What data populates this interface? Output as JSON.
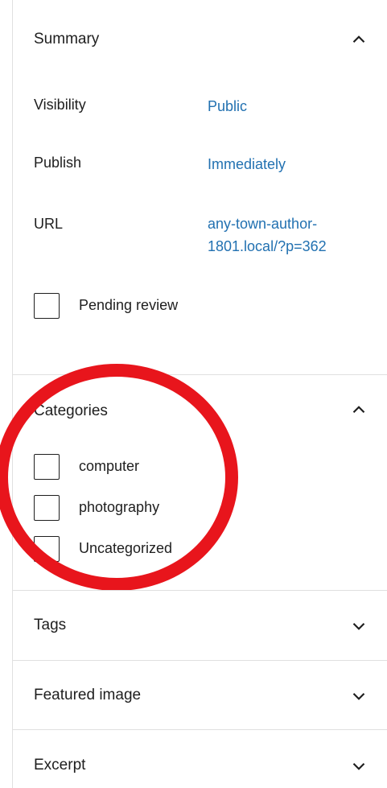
{
  "summary": {
    "title": "Summary",
    "visibility_label": "Visibility",
    "visibility_value": "Public",
    "publish_label": "Publish",
    "publish_value": "Immediately",
    "url_label": "URL",
    "url_line1": "any-town-author-",
    "url_line2": "1801.local/?p=362",
    "pending_review_label": "Pending review"
  },
  "categories": {
    "title": "Categories",
    "items": [
      {
        "label": "computer"
      },
      {
        "label": "photography"
      },
      {
        "label": "Uncategorized"
      }
    ]
  },
  "tags": {
    "title": "Tags"
  },
  "featured_image": {
    "title": "Featured image"
  },
  "excerpt": {
    "title": "Excerpt"
  },
  "icons": {
    "collapse": "chevron-up-icon",
    "expand": "chevron-down-icon"
  },
  "colors": {
    "link": "#2271b1",
    "annotation": "#e8151c",
    "divider": "#e0e0e0"
  }
}
